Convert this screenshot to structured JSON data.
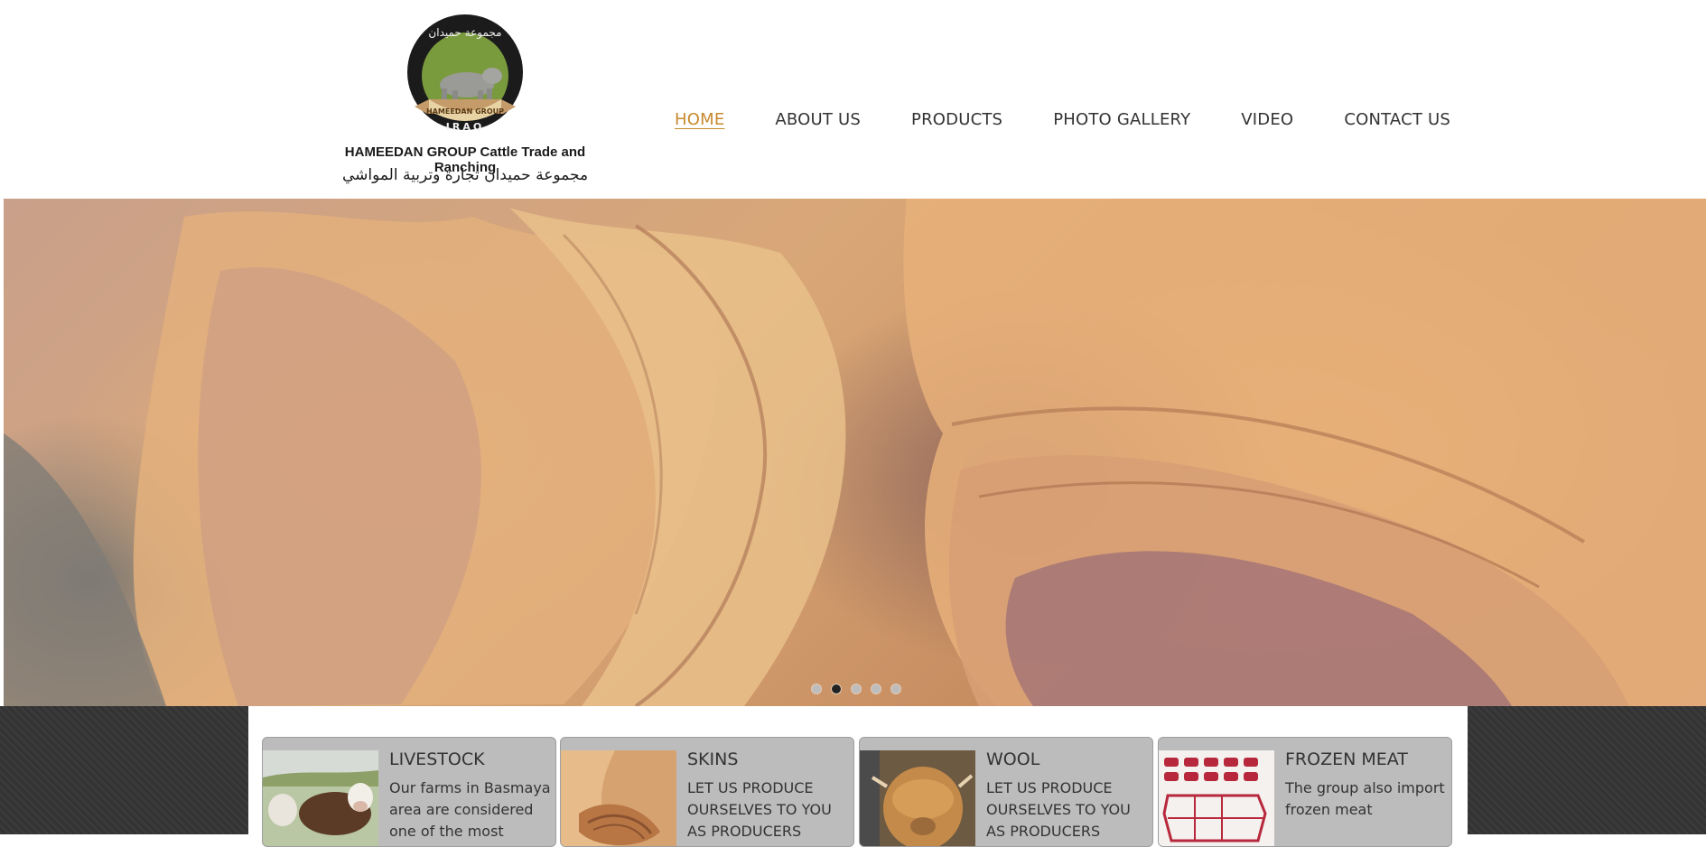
{
  "logo": {
    "emblem_top": "مجموعة حميدان",
    "emblem_ribbon": "HAMEEDAN GROUP",
    "emblem_bottom": "IRAQ",
    "line1": "HAMEEDAN GROUP  Cattle Trade and Ranching",
    "line2": "مجموعة حميدان تجارة وتربية المواشي"
  },
  "nav": {
    "items": [
      {
        "label": "HOME",
        "active": true
      },
      {
        "label": "ABOUT US"
      },
      {
        "label": "PRODUCTS"
      },
      {
        "label": "PHOTO GALLERY"
      },
      {
        "label": "VIDEO"
      },
      {
        "label": "CONTACT US"
      }
    ]
  },
  "slider": {
    "slide_count": 5,
    "active_index": 1
  },
  "cards": [
    {
      "title": "LIVESTOCK",
      "text": "Our farms in Basmaya area are considered one of the most",
      "thumb_icon": "cattle-thumbnail"
    },
    {
      "title": "SKINS",
      "text": "LET US PRODUCE OURSELVES TO YOU AS PRODUCERS",
      "thumb_icon": "leather-thumbnail"
    },
    {
      "title": "WOOL",
      "text": "LET US PRODUCE OURSELVES TO YOU AS PRODUCERS",
      "thumb_icon": "highland-cow-thumbnail"
    },
    {
      "title": "FROZEN MEAT",
      "text": "The group also import frozen meat",
      "thumb_icon": "meat-cuts-chart-thumbnail"
    }
  ],
  "colors": {
    "nav_active": "#c8892e",
    "nav_text": "#333333",
    "card_bg": "#bcbcbd",
    "logo_green": "#7a9a3e",
    "ribbon": "#c59b6a"
  }
}
